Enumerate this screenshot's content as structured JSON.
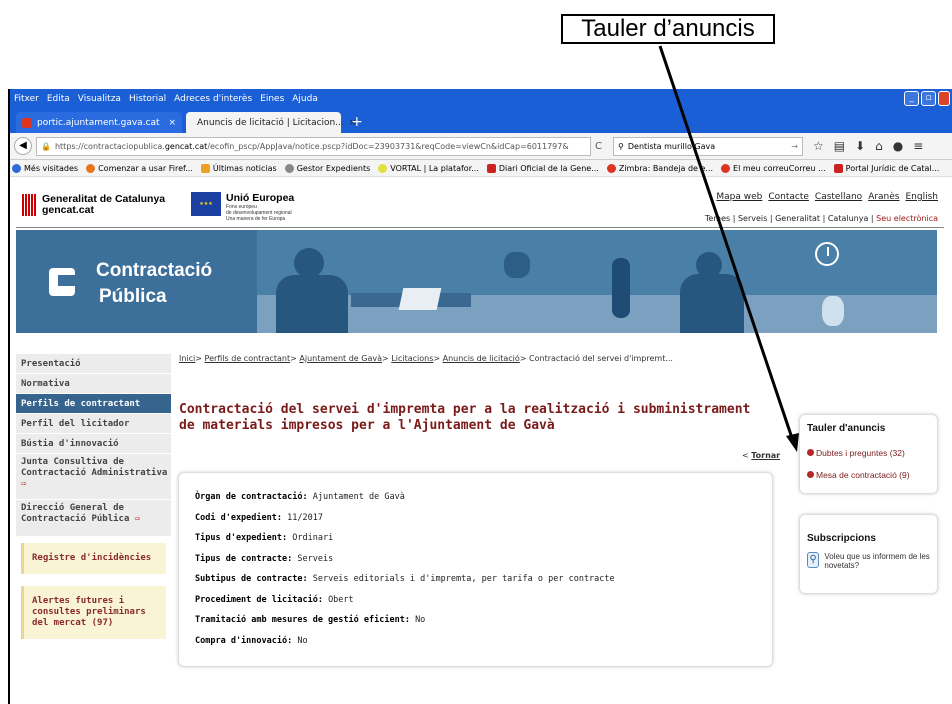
{
  "annotation": {
    "label": "Tauler d’anuncis"
  },
  "browser": {
    "menu": [
      "Fitxer",
      "Edita",
      "Visualitza",
      "Historial",
      "Adreces d'interès",
      "Eines",
      "Ajuda"
    ],
    "tabs": [
      {
        "label": "portic.ajuntament.gava.cat",
        "close": "×"
      },
      {
        "label": "Anuncis de licitació | Licitacion...",
        "close": "×"
      }
    ],
    "new_tab": "+",
    "url_prefix": "https://contractaciopublica.",
    "url_domain": "gencat.cat",
    "url_rest": "/ecofin_pscp/AppJava/notice.pscp?idDoc=23903731&reqCode=viewCn&idCap=6011797&",
    "search_value": "Dentista murillo Gava",
    "bookmarks": [
      "Més visitades",
      "Comenzar a usar Firef...",
      "Últimas noticias",
      "Gestor Expedients",
      "VORTAL | La platafor...",
      "Diari Oficial de la Gene...",
      "Zimbra: Bandeja de e...",
      "El meu correuCorreu ...",
      "Portal Jurídic de Catal..."
    ]
  },
  "header": {
    "gencat_name": "Generalitat de Catalunya",
    "gencat_domain": "gencat.cat",
    "eu_name": "Unió Europea",
    "eu_sub1": "Fons europeu",
    "eu_sub2": "de desenvolupament regional",
    "eu_sub3": "Una manera de fer Europa",
    "top_links": [
      "Mapa web",
      "Contacte",
      "Castellano",
      "Aranès",
      "English"
    ],
    "sub_links": [
      "Temes",
      "Serveis",
      "Generalitat",
      "Catalunya"
    ],
    "sub_sep": "|",
    "seu": "Seu electrònica",
    "banner_title_1": "Contractació",
    "banner_title_2": "Pública"
  },
  "sidebar": {
    "items": [
      "Presentació",
      "Normativa",
      "Perfils de contractant",
      "Perfil del licitador",
      "Bústia d'innovació"
    ],
    "junta": "Junta Consultiva de Contractació Administrativa",
    "direccio": "Direcció General de Contractació Pública",
    "ext_icon": "⇨",
    "registre": "Registre d'incidències",
    "alertes": "Alertes futures i consultes preliminars del mercat (97)"
  },
  "breadcrumb": {
    "items": [
      "Inici",
      "Perfils de contractant",
      "Ajuntament de Gavà",
      "Licitacions",
      "Anuncis de licitació"
    ],
    "sep": ">",
    "current": "Contractació del servei d'impremt..."
  },
  "main": {
    "title": "Contractació del servei d'impremta per a la realització i subministrament de materials impresos per a l'Ajuntament de Gavà",
    "back_prefix": "< ",
    "back": "Tornar",
    "details": [
      {
        "label": "Òrgan de contractació:",
        "value": "Ajuntament de Gavà"
      },
      {
        "label": "Codi d'expedient:",
        "value": "11/2017"
      },
      {
        "label": "Tipus d'expedient:",
        "value": "Ordinari"
      },
      {
        "label": "Tipus de contracte:",
        "value": "Serveis"
      },
      {
        "label": "Subtipus de contracte:",
        "value": "Serveis editorials i d'impremta, per tarifa o per contracte"
      },
      {
        "label": "Procediment de licitació:",
        "value": "Obert"
      },
      {
        "label": "Tramitació amb mesures de gestió eficient:",
        "value": "No"
      },
      {
        "label": "Compra d'innovació:",
        "value": "No"
      }
    ]
  },
  "tauler": {
    "title": "Tauler d'anuncis",
    "links": [
      "Dubtes i preguntes (32)",
      "Mesa de contractació (9)"
    ]
  },
  "subscripcions": {
    "title": "Subscripcions",
    "text": "Voleu que us informem de les novetats?"
  }
}
